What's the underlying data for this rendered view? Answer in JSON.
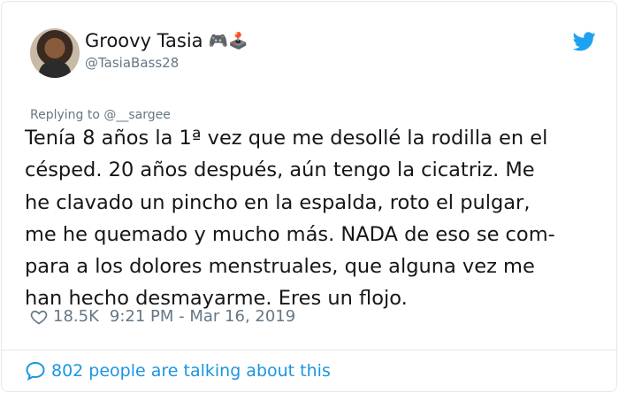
{
  "author": {
    "display_name": "Groovy Tasia",
    "emoji": "🎮🕹️",
    "handle": "@TasiaBass28"
  },
  "tweet": {
    "replying_to": "Replying to @__sargee",
    "lines": [
      "Tenía 8 años la 1ª vez que me desollé la rodilla en el",
      "césped. 20 años después, aún tengo la cicatriz. Me",
      "he clavado un pincho en la espalda, roto el pulgar,",
      "me he quemado y mucho más. NADA de eso se com-",
      "para a los dolores menstruales, que alguna vez me",
      "han hecho desmayarme. Eres un flojo."
    ],
    "likes": "18.5K",
    "timestamp": "9:21 PM - Mar 16, 2019"
  },
  "footer": {
    "talking": "802 people are talking about this"
  },
  "colors": {
    "twitter_blue": "#1da1f2",
    "link_blue": "#1b95e0",
    "muted_gray": "#657786"
  },
  "icons": {
    "brand": "twitter-bird-icon",
    "like": "heart-icon",
    "comment": "speech-bubble-icon"
  }
}
